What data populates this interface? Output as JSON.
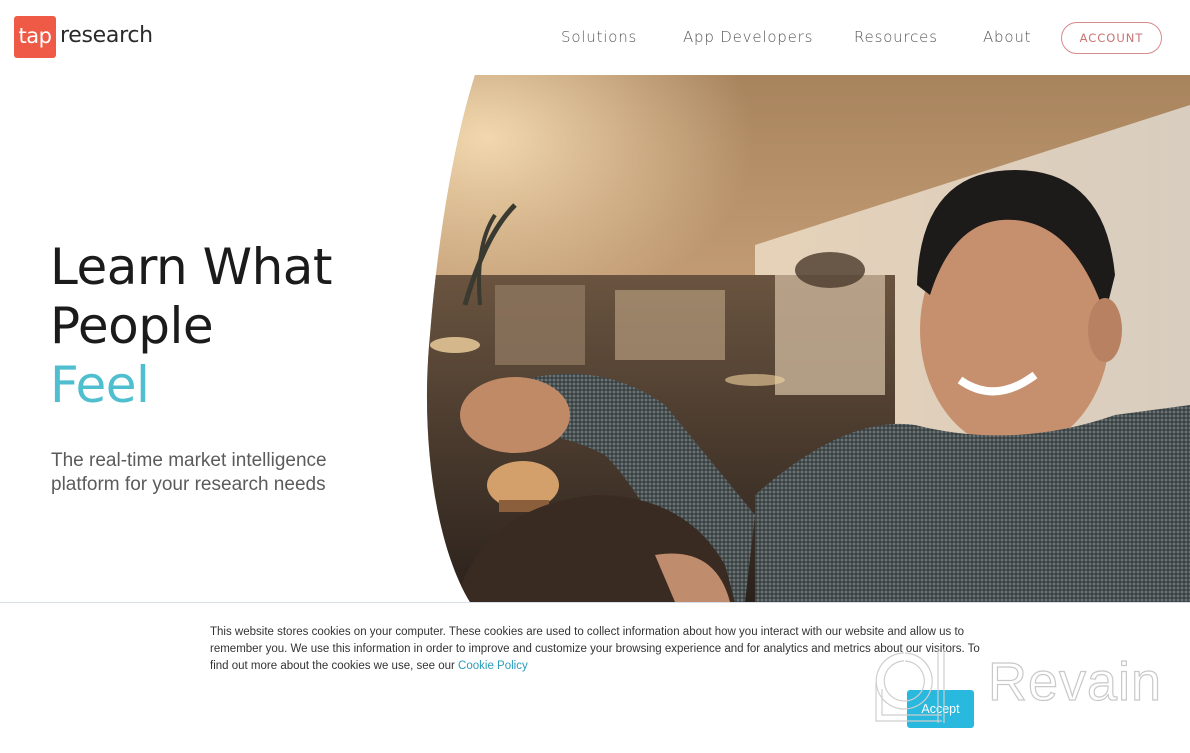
{
  "header": {
    "logo_mark": "tap",
    "logo_text": "research",
    "nav": [
      {
        "label": "Solutions"
      },
      {
        "label": "App Developers"
      },
      {
        "label": "Resources"
      },
      {
        "label": "About"
      }
    ],
    "account_label": "ACCOUNT"
  },
  "hero": {
    "title_line1": "Learn What",
    "title_line2": "People",
    "title_line3": "Feel",
    "subtitle": "The real-time market intelligence platform for your research needs",
    "image_alt": "Smiling man brushing a child's hair in a warmly lit living room"
  },
  "cookie_banner": {
    "text": "This website stores cookies on your computer. These cookies are used to collect information about how you interact with our website and allow us to remember you. We use this information in order to improve and customize your browsing experience and for analytics and metrics about our visitors. To find out more about the cookies we use, see our ",
    "link_label": "Cookie Policy",
    "accept_label": "Accept"
  },
  "watermark": {
    "text": "Revain"
  },
  "colors": {
    "brand": "#ee5a45",
    "accent_teal": "#4fbfd0",
    "account_outline": "#d68b8b",
    "accept_button": "#29b8de",
    "cookie_link": "#2a9dbc"
  }
}
